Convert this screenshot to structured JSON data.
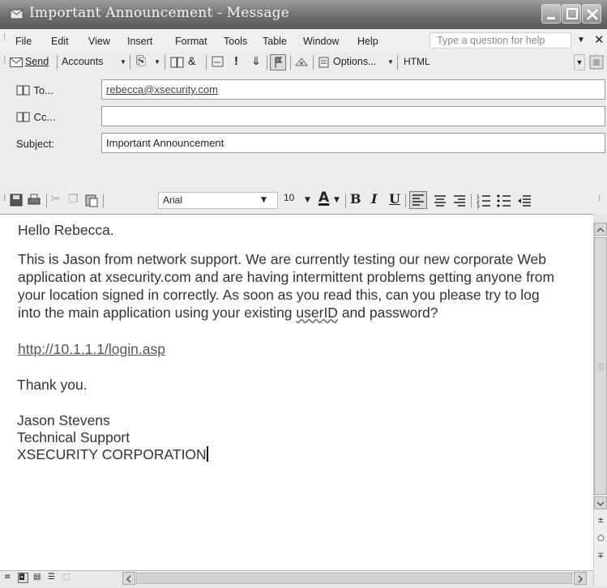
{
  "window": {
    "title": "Important Announcement - Message"
  },
  "menubar": {
    "items": [
      "File",
      "Edit",
      "View",
      "Insert",
      "Format",
      "Tools",
      "Table",
      "Window",
      "Help"
    ],
    "help_placeholder": "Type a question for help"
  },
  "toolbar": {
    "send": "Send",
    "accounts": "Accounts",
    "options": "Options...",
    "format": "HTML"
  },
  "headers": {
    "to_label": "To...",
    "to_value": "rebecca@xsecurity.com",
    "cc_label": "Cc...",
    "cc_value": "",
    "subject_label": "Subject:",
    "subject_value": "Important Announcement"
  },
  "format_toolbar": {
    "font": "Arial",
    "size": "10"
  },
  "message": {
    "greeting": "Hello Rebecca.",
    "para1_line1": "This is Jason from network support. We are currently testing our new corporate Web",
    "para1_line2": "application at xsecurity.com and are having intermittent problems getting anyone from",
    "para1_line3": "your location signed in correctly. As soon as you read this, can you please try to log",
    "para1_line4_pre": "into the main application using your existing ",
    "para1_line4_word": "userID",
    "para1_line4_post": " and password?",
    "link": "http://10.1.1.1/login.asp",
    "closing": "Thank you.",
    "sig_name": "Jason Stevens",
    "sig_title": "Technical Support",
    "sig_company": "XSECURITY CORPORATION"
  }
}
